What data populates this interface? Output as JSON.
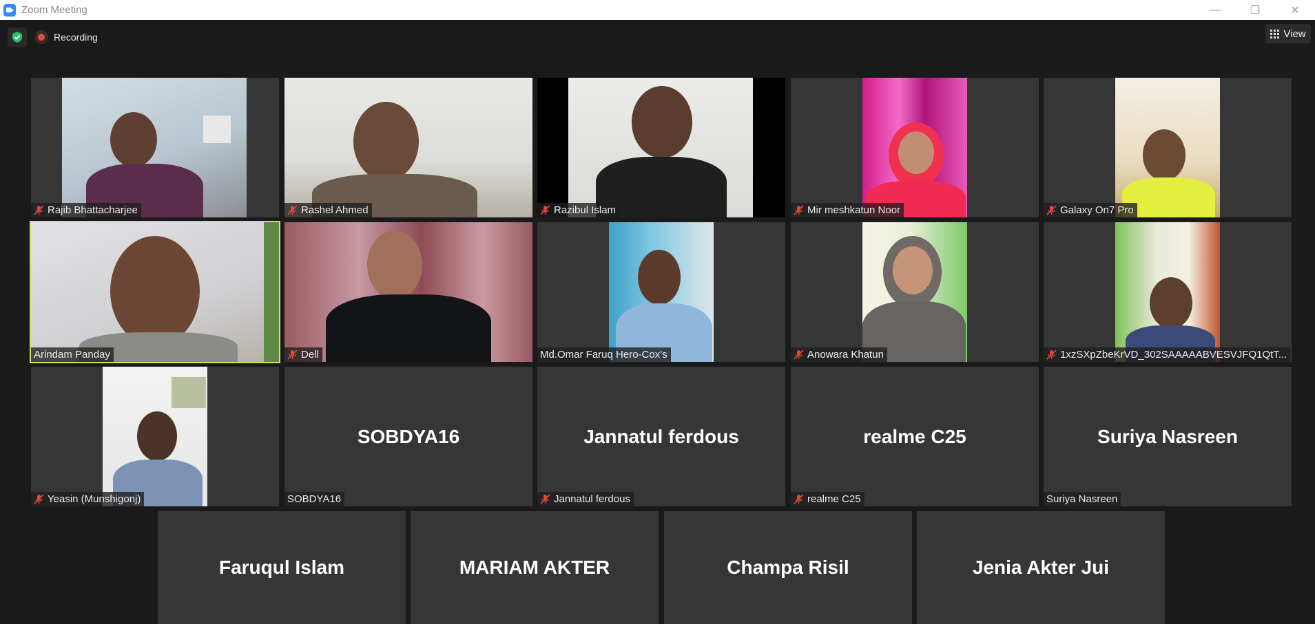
{
  "window": {
    "title": "Zoom Meeting",
    "minimize": "—",
    "restore": "❐",
    "close": "✕"
  },
  "toolbar": {
    "recording_label": "Recording",
    "view_label": "View"
  },
  "colors": {
    "active_speaker_border": "#cde06b",
    "recording": "#ef4b3b",
    "shield": "#23c16b"
  },
  "participants": [
    {
      "name": "Rajib Bhattacharjee",
      "muted": true
    },
    {
      "name": "Rashel Ahmed",
      "muted": true
    },
    {
      "name": "Razibul Islam",
      "muted": true
    },
    {
      "name": "Mir meshkatun Noor",
      "muted": true
    },
    {
      "name": "Galaxy On7 Pro",
      "muted": true
    },
    {
      "name": "Arindam Panday",
      "muted": false,
      "active_speaker": true
    },
    {
      "name": "Dell",
      "muted": true
    },
    {
      "name": "Md.Omar Faruq Hero-Cox's",
      "muted": false
    },
    {
      "name": "Anowara Khatun",
      "muted": true
    },
    {
      "name": "1xzSXpZbeKrVD_302SAAAAABVESVJFQ1QtT...",
      "muted": true
    },
    {
      "name": "Yeasin (Munshigonj)",
      "muted": true
    },
    {
      "name": "SOBDYA16",
      "big_name": "SOBDYA16",
      "muted": false
    },
    {
      "name": "Jannatul ferdous",
      "big_name": "Jannatul ferdous",
      "muted": true
    },
    {
      "name": "realme C25",
      "big_name": "realme C25",
      "muted": true
    },
    {
      "name": "Suriya Nasreen",
      "big_name": "Suriya Nasreen",
      "muted": false
    },
    {
      "big_name": "Faruqul Islam"
    },
    {
      "big_name": "MARIAM AKTER"
    },
    {
      "big_name": "Champa Risil"
    },
    {
      "big_name": "Jenia Akter Jui"
    }
  ]
}
